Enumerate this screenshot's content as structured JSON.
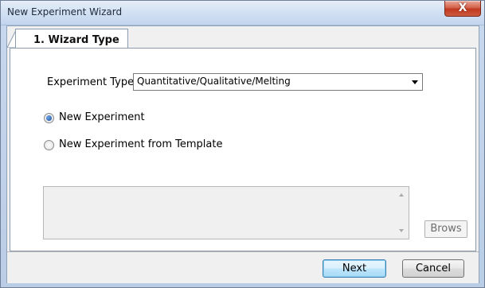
{
  "window": {
    "title": "New Experiment Wizard",
    "close_glyph": "X"
  },
  "tabs": [
    {
      "label": "1. Wizard Type"
    }
  ],
  "form": {
    "experiment_type_label": "Experiment Type",
    "experiment_type_value": "Quantitative/Qualitative/Melting",
    "options": [
      {
        "label": "New Experiment",
        "checked": true
      },
      {
        "label": "New Experiment from Template",
        "checked": false
      }
    ],
    "template_path_value": "",
    "browse_label": "Brows"
  },
  "footer": {
    "next_label": "Next",
    "cancel_label": "Cancel"
  },
  "colors": {
    "titlebar": "#d3e1f3",
    "close_button": "#c0391f",
    "default_button": "#bee6fd",
    "radio_checked": "#1d4f9a"
  },
  "icons": {
    "close": "close-icon",
    "dropdown": "chevron-down-icon",
    "scroll_up": "scroll-up-arrow-icon",
    "scroll_down": "scroll-down-arrow-icon"
  }
}
